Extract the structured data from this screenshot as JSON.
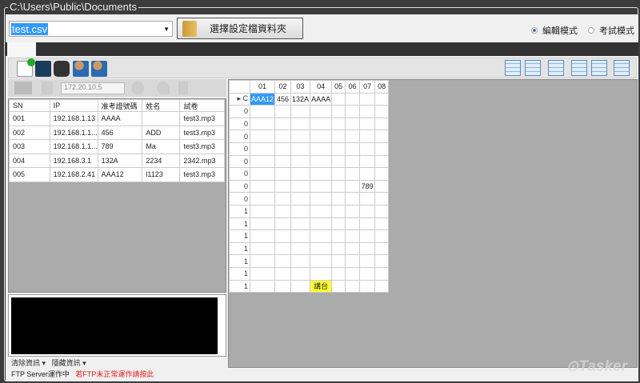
{
  "window": {
    "path": "C:\\Users\\Public\\Documents"
  },
  "file_combo": {
    "value": "test.csv"
  },
  "folder_button": {
    "label": "選擇設定檔資料夾"
  },
  "modes": [
    {
      "label": "編輯模式",
      "selected": true
    },
    {
      "label": "考試模式",
      "selected": false
    }
  ],
  "left_toolbar": {
    "ip_value": "172.20.10.5"
  },
  "student_table": {
    "columns": [
      "SN",
      "IP",
      "准考證號碼",
      "姓名",
      "試卷"
    ],
    "rows": [
      [
        "001",
        "192.168.1.13",
        "AAAA",
        "",
        "test3.mp3"
      ],
      [
        "002",
        "192.168.1.1...",
        "456",
        "ADD",
        "test3.mp3"
      ],
      [
        "003",
        "192.168.1.1...",
        "789",
        "Ma",
        "test3.mp3"
      ],
      [
        "004",
        "192.168.3.1",
        "132A",
        "2234",
        "2342.mp3"
      ],
      [
        "005",
        "192.168.2.41",
        "AAA12",
        "l1123",
        "test3.mp3"
      ]
    ]
  },
  "footer": {
    "clear_info": "清除資訊",
    "hide_info": "隱藏資訊",
    "ftp_status": "FTP Server運作中",
    "ftp_help": "若FTP未正常運作請按此"
  },
  "seat_grid": {
    "columns": [
      "01",
      "02",
      "03",
      "04",
      "05",
      "06",
      "07",
      "08"
    ],
    "row_labels": [
      "C",
      "0",
      "0",
      "0",
      "0",
      "0",
      "0",
      "0",
      "0",
      "1",
      "1",
      "1",
      "1",
      "1",
      "1",
      "1"
    ],
    "cells": [
      [
        "AAA12",
        "456",
        "132A",
        "AAAA",
        "",
        "",
        "",
        ""
      ],
      [
        "",
        "",
        "",
        "",
        "",
        "",
        "",
        ""
      ],
      [
        "",
        "",
        "",
        "",
        "",
        "",
        "",
        ""
      ],
      [
        "",
        "",
        "",
        "",
        "",
        "",
        "",
        ""
      ],
      [
        "",
        "",
        "",
        "",
        "",
        "",
        "",
        ""
      ],
      [
        "",
        "",
        "",
        "",
        "",
        "",
        "",
        ""
      ],
      [
        "",
        "",
        "",
        "",
        "",
        "",
        "",
        ""
      ],
      [
        "",
        "",
        "",
        "",
        "",
        "",
        "789",
        ""
      ],
      [
        "",
        "",
        "",
        "",
        "",
        "",
        "",
        ""
      ],
      [
        "",
        "",
        "",
        "",
        "",
        "",
        "",
        ""
      ],
      [
        "",
        "",
        "",
        "",
        "",
        "",
        "",
        ""
      ],
      [
        "",
        "",
        "",
        "",
        "",
        "",
        "",
        ""
      ],
      [
        "",
        "",
        "",
        "",
        "",
        "",
        "",
        ""
      ],
      [
        "",
        "",
        "",
        "",
        "",
        "",
        "",
        ""
      ],
      [
        "",
        "",
        "",
        "",
        "",
        "",
        "",
        ""
      ],
      [
        "",
        "",
        "",
        "講台",
        "",
        "",
        "",
        ""
      ]
    ]
  },
  "watermark": "Tasker",
  "colors": {
    "selection": "#3399ff",
    "podium": "#ffff33",
    "ftp_help": "#e02020"
  }
}
